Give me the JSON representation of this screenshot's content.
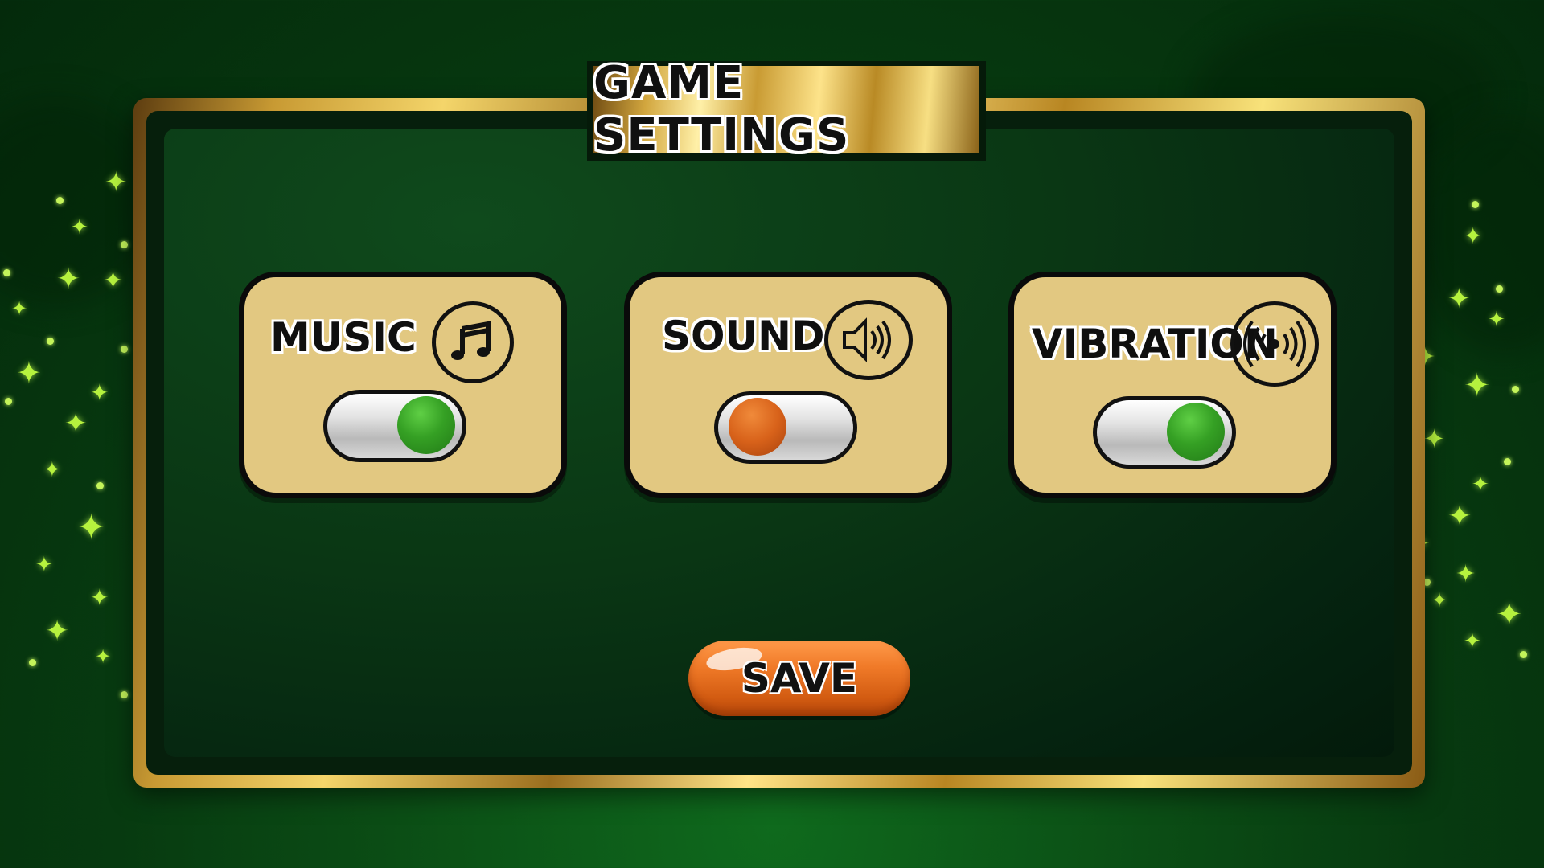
{
  "title": "GAME SETTINGS",
  "settings": [
    {
      "label": "MUSIC",
      "icon": "music-note-icon",
      "state": "on"
    },
    {
      "label": "SOUND",
      "icon": "speaker-icon",
      "state": "off"
    },
    {
      "label": "VIBRATION",
      "icon": "vibration-icon",
      "state": "on"
    }
  ],
  "save_label": "SAVE",
  "colors": {
    "toggle_on": "#35a024",
    "toggle_off": "#d8621a",
    "card": "#e2c881",
    "gold": "#d2a63e"
  }
}
